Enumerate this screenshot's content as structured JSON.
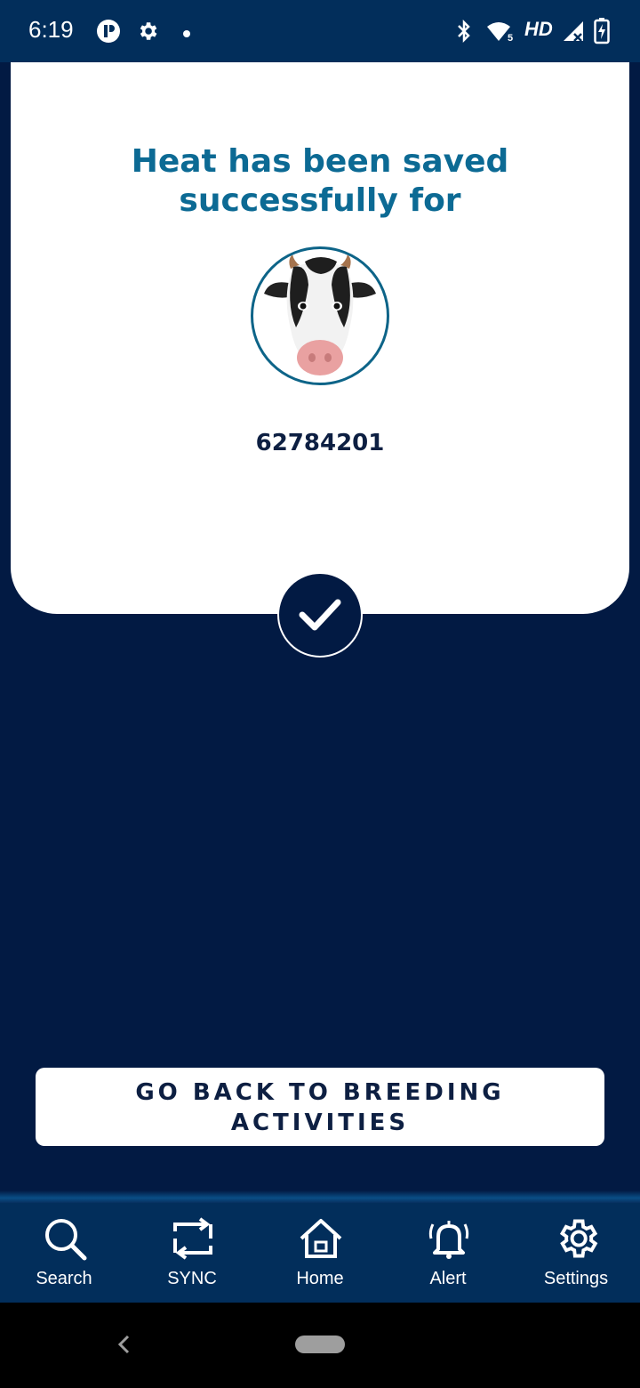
{
  "status_bar": {
    "time": "6:19",
    "network_label": "HD",
    "icons": [
      "app-p-icon",
      "settings-gear-icon",
      "dot-icon",
      "bluetooth-icon",
      "wifi-icon",
      "signal-icon",
      "battery-charging-icon"
    ]
  },
  "card": {
    "title_line1": "Heat has been saved",
    "title_line2": "successfully for",
    "animal_id": "62784201",
    "avatar_icon": "cow-face-icon",
    "status_icon": "check-icon"
  },
  "colors": {
    "background": "#021A43",
    "title": "#0C6A94",
    "nav_bar": "#022E5B"
  },
  "actions": {
    "back_line1": "GO BACK TO BREEDING",
    "back_line2": "ACTIVITIES"
  },
  "bottom_nav": {
    "items": [
      {
        "label": "Search",
        "icon": "search-icon"
      },
      {
        "label": "SYNC",
        "icon": "sync-icon"
      },
      {
        "label": "Home",
        "icon": "home-icon"
      },
      {
        "label": "Alert",
        "icon": "bell-icon"
      },
      {
        "label": "Settings",
        "icon": "gear-icon"
      }
    ]
  }
}
